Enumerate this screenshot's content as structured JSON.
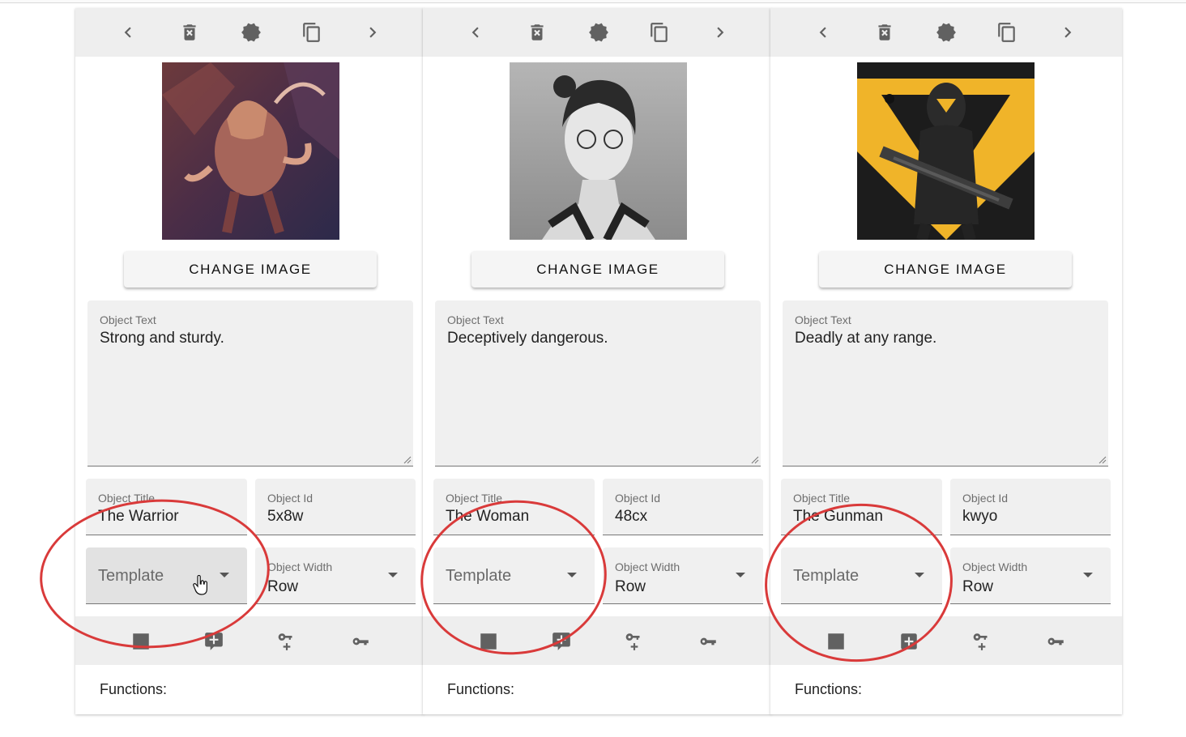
{
  "icons": {
    "prev": "chevron-left-icon",
    "delete": "delete-box-icon",
    "badge": "badge-icon",
    "copy": "copy-icon",
    "next": "chevron-right-icon",
    "count": "numeric-9-plus-box-icon",
    "comment": "comment-plus-icon",
    "key_plus": "key-plus-icon",
    "key": "key-icon"
  },
  "annotation_color": "#d93a3a",
  "cards": [
    {
      "change_image_label": "CHANGE IMAGE",
      "object_text": {
        "label": "Object Text",
        "value": "Strong and sturdy."
      },
      "object_title": {
        "label": "Object Title",
        "value": "The Warrior"
      },
      "object_id": {
        "label": "Object Id",
        "value": "5x8w"
      },
      "template": {
        "placeholder": "Template"
      },
      "object_width": {
        "label": "Object Width",
        "value": "Row"
      },
      "functions_label": "Functions:"
    },
    {
      "change_image_label": "CHANGE IMAGE",
      "object_text": {
        "label": "Object Text",
        "value": "Deceptively dangerous."
      },
      "object_title": {
        "label": "Object Title",
        "value": "The Woman"
      },
      "object_id": {
        "label": "Object Id",
        "value": "48cx"
      },
      "template": {
        "placeholder": "Template"
      },
      "object_width": {
        "label": "Object Width",
        "value": "Row"
      },
      "functions_label": "Functions:"
    },
    {
      "change_image_label": "CHANGE IMAGE",
      "object_text": {
        "label": "Object Text",
        "value": "Deadly at any range."
      },
      "object_title": {
        "label": "Object Title",
        "value": "The Gunman"
      },
      "object_id": {
        "label": "Object Id",
        "value": "kwyo"
      },
      "template": {
        "placeholder": "Template"
      },
      "object_width": {
        "label": "Object Width",
        "value": "Row"
      },
      "functions_label": "Functions:"
    }
  ]
}
